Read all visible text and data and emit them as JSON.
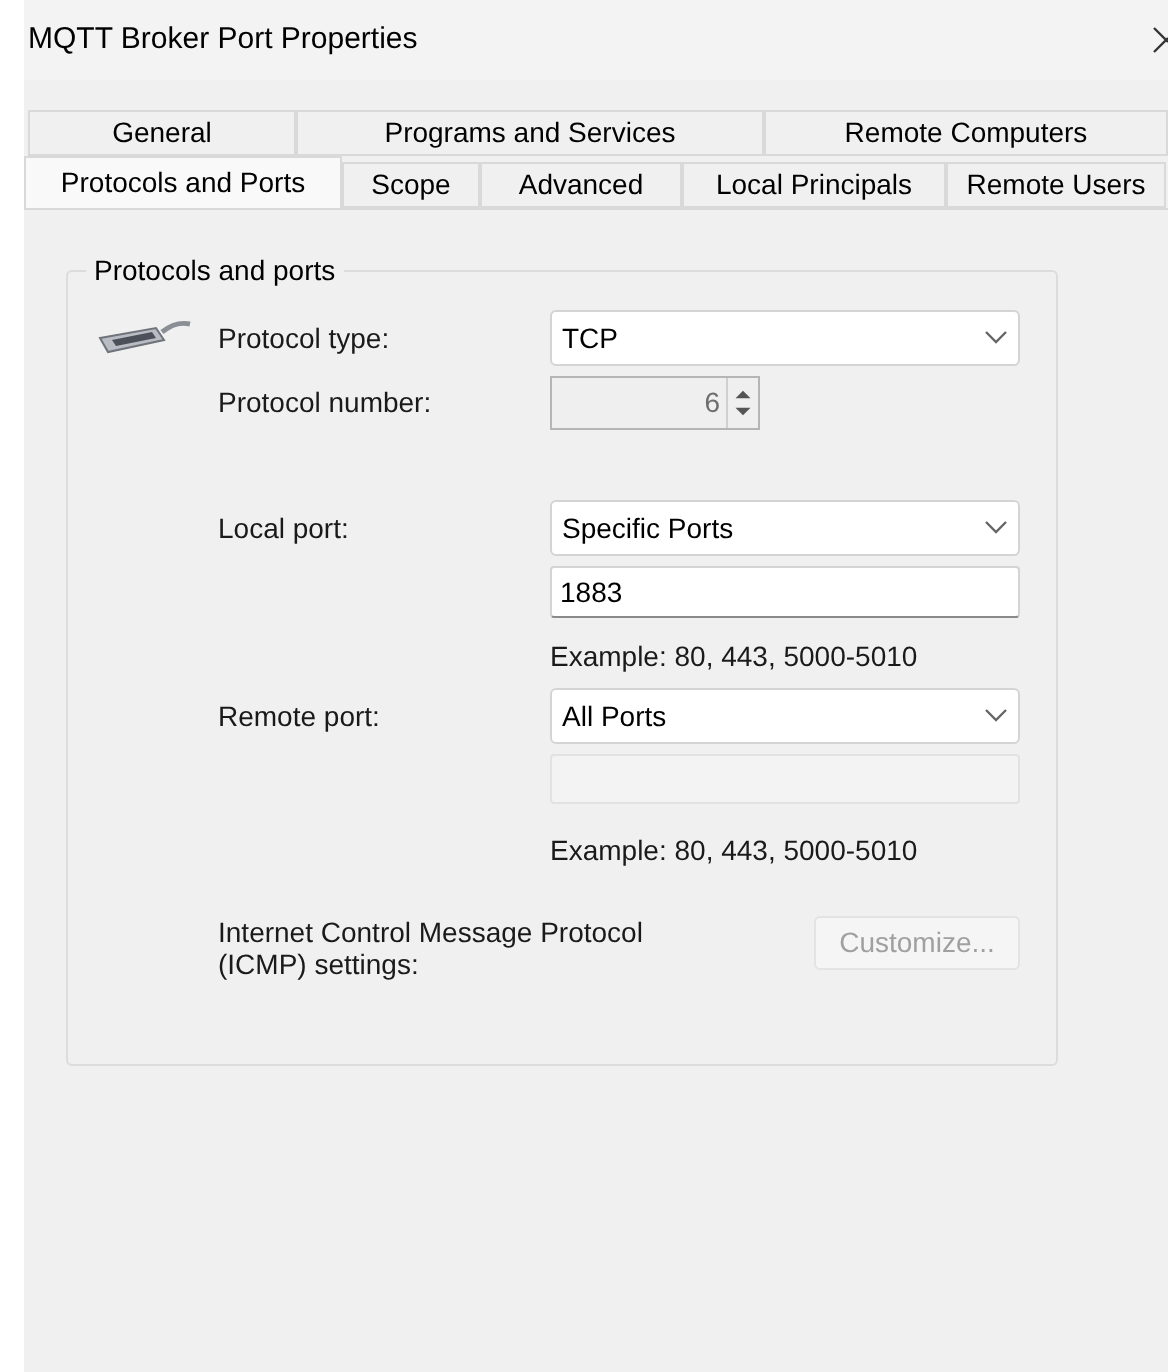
{
  "window": {
    "title": "MQTT Broker Port Properties"
  },
  "tab_rows": [
    [
      {
        "label": "General",
        "selected": false
      },
      {
        "label": "Programs and Services",
        "selected": false
      },
      {
        "label": "Remote Computers",
        "selected": false
      }
    ],
    [
      {
        "label": "Protocols and Ports",
        "selected": true
      },
      {
        "label": "Scope",
        "selected": false
      },
      {
        "label": "Advanced",
        "selected": false
      },
      {
        "label": "Local Principals",
        "selected": false
      },
      {
        "label": "Remote Users",
        "selected": false
      }
    ]
  ],
  "group": {
    "title": "Protocols and ports",
    "protocol_type": {
      "label": "Protocol type:",
      "value": "TCP"
    },
    "protocol_number": {
      "label": "Protocol number:",
      "value": "6",
      "disabled": true
    },
    "local_port": {
      "label": "Local port:",
      "value": "Specific Ports"
    },
    "local_ports_input": {
      "value": "1883",
      "disabled": false
    },
    "local_example": "Example: 80, 443, 5000-5010",
    "remote_port": {
      "label": "Remote port:",
      "value": "All Ports"
    },
    "remote_ports_input": {
      "disabled": true
    },
    "remote_example": "Example: 80, 443, 5000-5010",
    "icmp_label": "Internet Control Message Protocol (ICMP) settings:",
    "customize_button": {
      "label": "Customize...",
      "disabled": true
    }
  }
}
